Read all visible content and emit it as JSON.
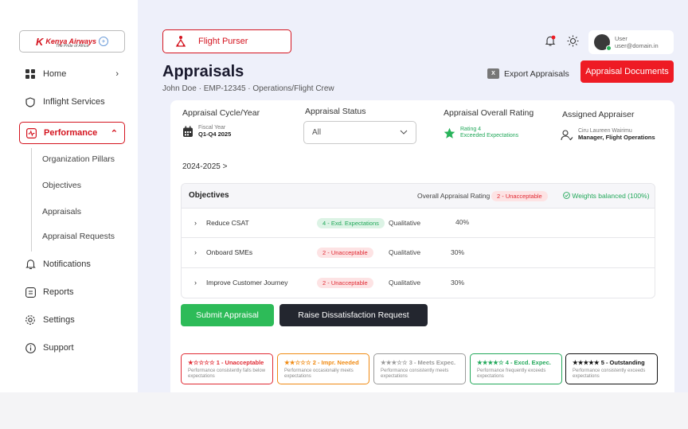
{
  "brand": {
    "name": "Kenya Airways",
    "tagline": "The Pride of Africa"
  },
  "sidebar": {
    "items": [
      {
        "label": "Home",
        "icon": "grid-icon"
      },
      {
        "label": "Inflight Services",
        "icon": "shield-icon"
      },
      {
        "label": "Performance",
        "icon": "activity-icon",
        "active": true
      },
      {
        "label": "Notifications",
        "icon": "bell-icon"
      },
      {
        "label": "Reports",
        "icon": "document-icon"
      },
      {
        "label": "Settings",
        "icon": "gear-icon"
      },
      {
        "label": "Support",
        "icon": "info-icon"
      }
    ],
    "subitems": [
      "Organization Pillars",
      "Objectives",
      "Appraisals",
      "Appraisal Requests"
    ]
  },
  "header": {
    "role": "Flight Purser",
    "user_name": "User",
    "user_email": "user@domain.in"
  },
  "page": {
    "title": "Appraisals",
    "subtitle": "John Doe · EMP-12345 · Operations/Flight Crew",
    "export_label": "Export Appraisals",
    "docs_label": "Appraisal Documents"
  },
  "fields": {
    "cycle_label": "Appraisal Cycle/Year",
    "cycle_small": "Fiscal Year",
    "cycle_value": "Q1-Q4 2025",
    "status_label": "Appraisal Status",
    "status_value": "All",
    "rating_label": "Appraisal Overall Rating",
    "rating_small": "Rating 4",
    "rating_value": "Exceeded Expectations",
    "appraiser_label": "Assigned Appraiser",
    "appraiser_name": "Ciru Laureen Wairimu",
    "appraiser_role": "Manager, Flight Operations"
  },
  "breadcrumb": "2024-2025 >",
  "objectives": {
    "title": "Objectives",
    "overall_label": "Overall Appraisal Rating",
    "overall_value": "2 - Unacceptable",
    "balanced": "Weights balanced (100%)",
    "rows": [
      {
        "name": "Reduce CSAT",
        "rating": "4 - Exd. Expectations",
        "type": "Qualitative",
        "weight": "40%",
        "status": "green"
      },
      {
        "name": "Onboard SMEs",
        "rating": "2 - Unacceptable",
        "type": "Qualitative",
        "weight": "30%",
        "status": "red"
      },
      {
        "name": "Improve Customer Journey",
        "rating": "2 - Unacceptable",
        "type": "Qualitative",
        "weight": "30%",
        "status": "red"
      }
    ]
  },
  "actions": {
    "submit": "Submit Appraisal",
    "raise": "Raise Dissatisfaction Request"
  },
  "legend": [
    {
      "stars": "★☆☆☆☆",
      "label": "1 - Unacceptable",
      "desc": "Performance consistently falls below expectations",
      "color": "#e02a33"
    },
    {
      "stars": "★★☆☆☆",
      "label": "2 - Impr. Needed",
      "desc": "Performance occasionally meets expectations",
      "color": "#f08a12"
    },
    {
      "stars": "★★★☆☆",
      "label": "3 - Meets Expec.",
      "desc": "Performance consistently meets expectations",
      "color": "#9a9a9a"
    },
    {
      "stars": "★★★★☆",
      "label": "4 - Excd. Expec.",
      "desc": "Performance frequently exceeds expectations",
      "color": "#22a85a"
    },
    {
      "stars": "★★★★★",
      "label": "5 - Outstanding",
      "desc": "Performance consistently exceeds expectations",
      "color": "#111111"
    }
  ]
}
